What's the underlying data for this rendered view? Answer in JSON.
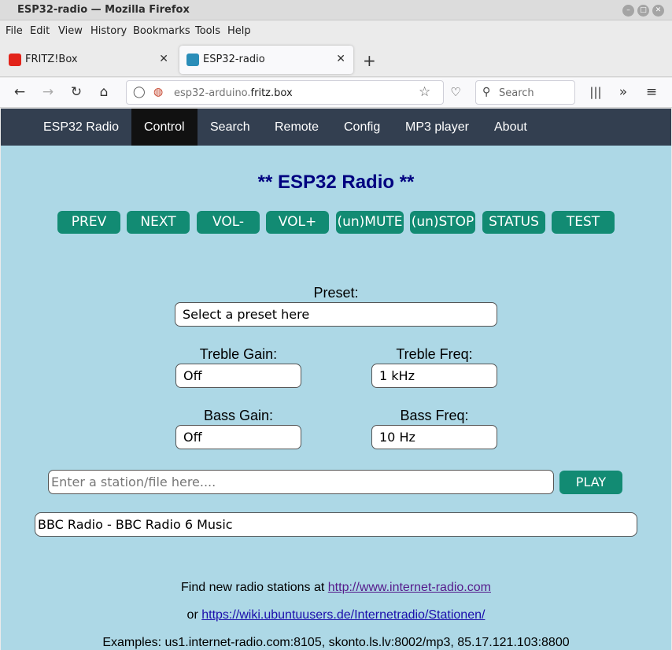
{
  "window": {
    "title": "ESP32-radio — Mozilla Firefox"
  },
  "menu": [
    "File",
    "Edit",
    "View",
    "History",
    "Bookmarks",
    "Tools",
    "Help"
  ],
  "tabs": [
    {
      "label": "FRITZ!Box",
      "active": false
    },
    {
      "label": "ESP32-radio",
      "active": true
    }
  ],
  "urlbar": {
    "url_prefix": "esp32-arduino.",
    "url_domain": "fritz.box"
  },
  "search": {
    "placeholder": "Search"
  },
  "site_nav": [
    "ESP32 Radio",
    "Control",
    "Search",
    "Remote",
    "Config",
    "MP3 player",
    "About"
  ],
  "heading": "** ESP32 Radio **",
  "controls": [
    "PREV",
    "NEXT",
    "VOL-",
    "VOL+",
    "(un)MUTE",
    "(un)STOP",
    "STATUS",
    "TEST"
  ],
  "preset": {
    "label": "Preset:",
    "value": "Select a preset here"
  },
  "treble_gain": {
    "label": "Treble Gain:",
    "value": "Off"
  },
  "treble_freq": {
    "label": "Treble Freq:",
    "value": "1 kHz"
  },
  "bass_gain": {
    "label": "Bass Gain:",
    "value": "Off"
  },
  "bass_freq": {
    "label": "Bass Freq:",
    "value": "10 Hz"
  },
  "station": {
    "placeholder": "Enter a station/file here....",
    "play": "PLAY"
  },
  "now_playing": "BBC Radio - BBC Radio 6 Music",
  "footer": {
    "line1": "Find new radio stations at ",
    "link1": "http://www.internet-radio.com",
    "or": "or ",
    "link2": "https://wiki.ubuntuusers.de/Internetradio/Stationen/",
    "examples": "Examples: us1.internet-radio.com:8105, skonto.ls.lv:8002/mp3, 85.17.121.103:8800"
  },
  "colors": {
    "page_bg": "#add8e6",
    "button": "#128b73",
    "nav_bg": "#333f50",
    "heading": "#000080"
  }
}
